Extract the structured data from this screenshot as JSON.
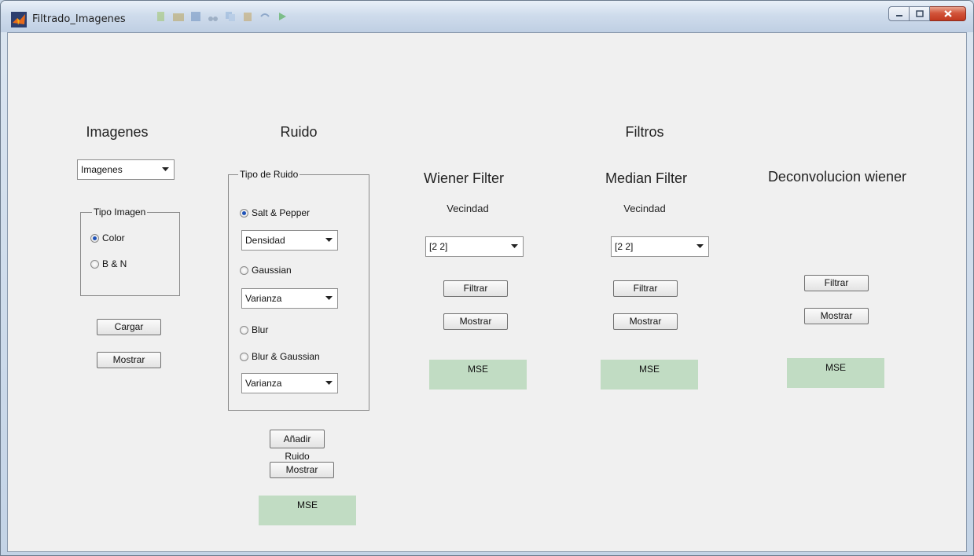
{
  "window": {
    "title": "Filtrado_Imagenes",
    "toolbar_icons": [
      "new-icon",
      "open-icon",
      "save-icon",
      "cut-icon",
      "copy-icon",
      "paste-icon",
      "undo-icon",
      "run-icon"
    ],
    "controls": [
      "minimize-icon",
      "maximize-icon",
      "close-icon"
    ]
  },
  "imagenes": {
    "heading": "Imagenes",
    "select_value": "Imagenes",
    "group_label": "Tipo Imagen",
    "radios": [
      {
        "label": "Color",
        "checked": true
      },
      {
        "label": "B & N",
        "checked": false
      }
    ],
    "cargar_label": "Cargar",
    "mostrar_label": "Mostrar"
  },
  "ruido": {
    "heading": "Ruido",
    "group_label": "Tipo de Ruido",
    "radios": [
      {
        "label": "Salt & Pepper",
        "checked": true
      },
      {
        "label": "Gaussian",
        "checked": false
      },
      {
        "label": "Blur",
        "checked": false
      },
      {
        "label": "Blur & Gaussian",
        "checked": false
      }
    ],
    "selects": [
      "Densidad",
      "Varianza",
      "Varianza"
    ],
    "anadir_label": "Añadir Ruido",
    "mostrar_label": "Mostrar",
    "mse_label": "MSE"
  },
  "filtros": {
    "heading": "Filtros",
    "wiener": {
      "title": "Wiener Filter",
      "vecindad_label": "Vecindad",
      "select_value": "[2 2]",
      "filtrar_label": "Filtrar",
      "mostrar_label": "Mostrar",
      "mse_label": "MSE"
    },
    "median": {
      "title": "Median Filter",
      "vecindad_label": "Vecindad",
      "select_value": "[2 2]",
      "filtrar_label": "Filtrar",
      "mostrar_label": "Mostrar",
      "mse_label": "MSE"
    },
    "deconv": {
      "title": "Deconvolucion wiener",
      "filtrar_label": "Filtrar",
      "mostrar_label": "Mostrar",
      "mse_label": "MSE"
    }
  },
  "colors": {
    "mse_background": "#c1dcc3",
    "radio_dot": "#1e52b8",
    "close_button": "#c1381e"
  }
}
